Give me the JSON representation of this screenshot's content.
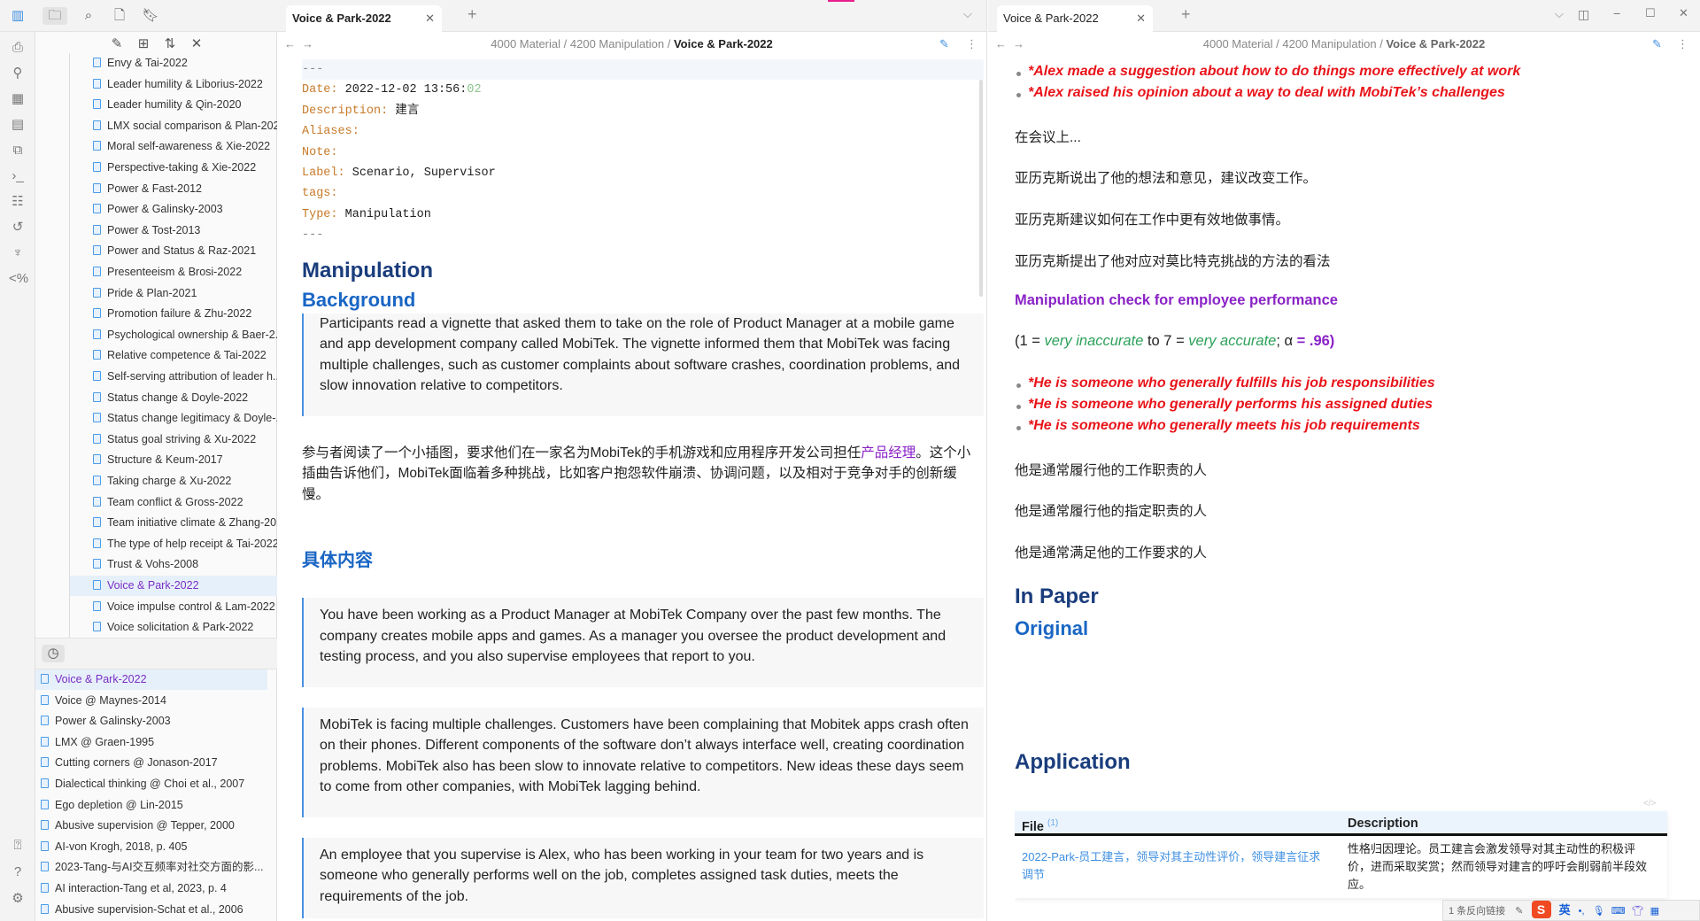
{
  "ribbon": {
    "icons": [
      "sidebar-toggle-icon",
      "file-search-icon",
      "graph-icon",
      "grid-icon",
      "calendar-icon",
      "copy-icon",
      "terminal-icon",
      "table-icon",
      "history-icon",
      "bone-icon",
      "template-icon",
      "vault-icon",
      "help-icon",
      "settings-icon"
    ]
  },
  "sidebar": {
    "files": [
      "Envy & Tai-2022",
      "Leader humility & Liborius-2022",
      "Leader humility & Qin-2020",
      "LMX social comparison & Plan-2021",
      "Moral self-awareness & Xie-2022",
      "Perspective-taking & Xie-2022",
      "Power & Fast-2012",
      "Power & Galinsky-2003",
      "Power & Tost-2013",
      "Power and Status & Raz-2021",
      "Presenteeism & Brosi-2022",
      "Pride & Plan-2021",
      "Promotion failure & Zhu-2022",
      "Psychological ownership & Baer-2...",
      "Relative competence & Tai-2022",
      "Self-serving attribution of leader h...",
      "Status change & Doyle-2022",
      "Status change legitimacy & Doyle-...",
      "Status goal striving & Xu-2022",
      "Structure & Keum-2017",
      "Taking charge & Xu-2022",
      "Team conflict & Gross-2022",
      "Team initiative climate & Zhang-20...",
      "The type of help receipt & Tai-2022",
      "Trust & Vohs-2008",
      "Voice & Park-2022",
      "Voice impulse control & Lam-2022",
      "Voice solicitation & Park-2022"
    ],
    "active_file": "Voice & Park-2022",
    "recent": [
      "Voice & Park-2022",
      "Voice @ Maynes-2014",
      "Power & Galinsky-2003",
      "LMX @ Graen-1995",
      "Cutting corners @ Jonason-2017",
      "Dialectical thinking @ Choi et al., 2007",
      "Ego depletion @ Lin-2015",
      "Abusive supervision @ Tepper, 2000",
      "AI-von Krogh, 2018, p. 405",
      "2023-Tang-与AI交互频率对社交方面的影...",
      "AI interaction-Tang et al, 2023, p. 4",
      "Abusive supervision-Schat et al., 2006"
    ]
  },
  "left": {
    "tab": "Voice & Park-2022",
    "crumb": [
      "4000 Material",
      "4200 Manipulation",
      "Voice & Park-2022"
    ],
    "fm": {
      "dash": "---",
      "date_k": "Date:",
      "date_v": "2022-12-02 13:56:",
      "date_s": "02",
      "desc_k": "Description:",
      "desc_v": "建言",
      "alias_k": "Aliases:",
      "note_k": "Note:",
      "label_k": "Label:",
      "label_v": "Scenario, Supervisor",
      "tags_k": "tags:",
      "type_k": "Type:",
      "type_v": "Manipulation"
    },
    "h_manip": "Manipulation",
    "h_bg": "Background",
    "bq1": "Participants read a vignette that asked them to take on the role of Product Manager at a mobile game and app development company called MobiTek. The vignette informed them that MobiTek was facing multiple challenges, such as customer complaints about software crashes, coordination problems, and slow innovation relative to competitors.",
    "zh1a": "参与者阅读了一个小插图，要求他们在一家名为MobiTek的手机游戏和应用程序开发公司担任",
    "zh1b": "产品经理",
    "zh1c": "。这个小插曲告诉他们，MobiTek面临着多种挑战，比如客户抱怨软件崩溃、协调问题，以及相对于竞争对手的创新缓慢。",
    "h_content": "具体内容",
    "bq2": "You have been working as a Product Manager at MobiTek Company over the past few months. The company creates mobile apps and games. As a manager you oversee the product development and testing process, and you also supervise employees that report to you.",
    "bq3": "MobiTek is facing multiple challenges. Customers have been complaining that Mobitek apps crash often on their phones. Different components of the software don’t always interface well, creating coordination problems. MobiTek also has been slow to innovate relative to competitors. New ideas these days seem to come from other companies, with MobiTek lagging behind.",
    "bq4": "An employee that you supervise is Alex, who has been working in your team for two years and is someone who generally performs well on the job, completes assigned task duties, meets the requirements of the job."
  },
  "right": {
    "tab": "Voice & Park-2022",
    "crumb": [
      "4000 Material",
      "4200 Manipulation",
      "Voice & Park-2022"
    ],
    "b1": "*Alex made a suggestion about how to do things more effectively at work",
    "b2": "*Alex raised his opinion about a way to deal with MobiTek’s challenges",
    "zh": [
      "在会议上...",
      "亚历克斯说出了他的想法和意见，建议改变工作。",
      "亚历克斯建议如何在工作中更有效地做事情。",
      "亚历克斯提出了他对应对莫比特克挑战的方法的看法"
    ],
    "check": "Manipulation check for employee performance",
    "scale": {
      "a": "(1 = ",
      "b": "very inaccurate",
      "c": " to 7 = ",
      "d": "very accurate",
      "e": "; α ",
      "f": "= .96)"
    },
    "items": [
      "*He is someone who generally fulfills his job responsibilities",
      "*He is someone who generally performs his assigned duties",
      "*He is someone who generally meets his job requirements"
    ],
    "zh2": [
      "他是通常履行他的工作职责的人",
      "他是通常履行他的指定职责的人",
      "他是通常满足他的工作要求的人"
    ],
    "h_paper": "In Paper",
    "h_orig": "Original",
    "h_app": "Application",
    "table": {
      "col1": "File",
      "col1_count": "(1)",
      "col2": "Description",
      "link": "2022-Park-员工建言，领导对其主动性评价，领导建言征求调节",
      "desc": "性格归因理论。员工建言会激发领导对其主动性的积极评价，进而采取奖赏；然而领导对建言的呼吁会削弱前半段效应。"
    }
  },
  "status": {
    "backlinks": "1 条反向链接",
    "ime": "英"
  },
  "colors": {
    "accent": "#7a2ec4",
    "heading": "#1a3d7c",
    "red": "#e8141a"
  }
}
